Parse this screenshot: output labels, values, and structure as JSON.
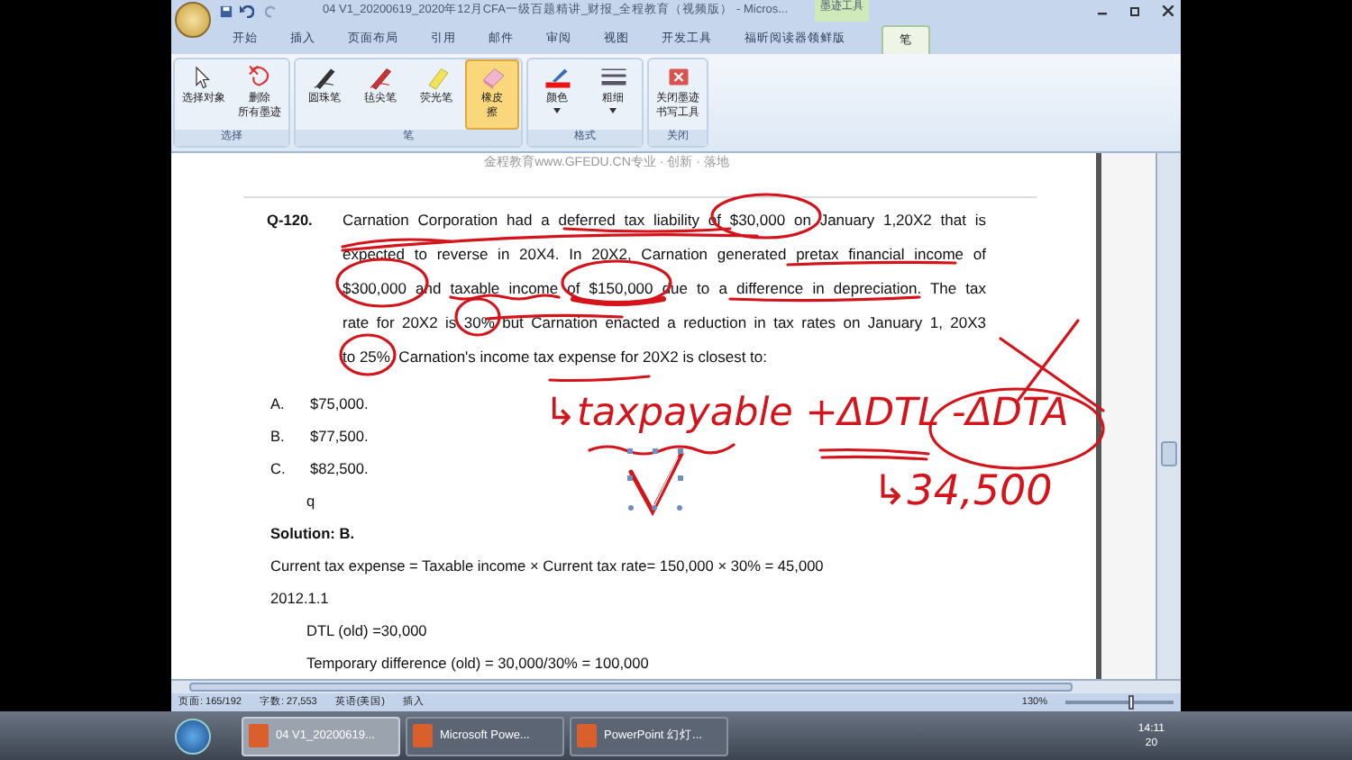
{
  "window": {
    "title": "04 V1_20200619_2020年12月CFA一级百题精讲_财报_全程教育（视频版） - Micros...",
    "contextual_tab": "墨迹工具"
  },
  "tabs": [
    {
      "label": "开始",
      "selected": false
    },
    {
      "label": "插入",
      "selected": false
    },
    {
      "label": "页面布局",
      "selected": false
    },
    {
      "label": "引用",
      "selected": false
    },
    {
      "label": "邮件",
      "selected": false
    },
    {
      "label": "审阅",
      "selected": false
    },
    {
      "label": "视图",
      "selected": false
    },
    {
      "label": "开发工具",
      "selected": false
    },
    {
      "label": "福昕阅读器领鲜版",
      "selected": false
    },
    {
      "label": "笔",
      "selected": true
    }
  ],
  "ribbon": [
    {
      "label": "选择",
      "buttons": [
        {
          "kind": "pointer",
          "lines": [
            "选择对象"
          ],
          "dropdown": false,
          "selected": false
        },
        {
          "kind": "erase-all",
          "lines": [
            "删除",
            "所有墨迹"
          ],
          "dropdown": false,
          "selected": false
        }
      ]
    },
    {
      "label": "笔",
      "buttons": [
        {
          "kind": "ballpoint",
          "lines": [
            "圆珠笔"
          ],
          "dropdown": false,
          "selected": false
        },
        {
          "kind": "felt",
          "lines": [
            "毡尖笔"
          ],
          "dropdown": false,
          "selected": false
        },
        {
          "kind": "highlighter",
          "lines": [
            "荧光笔"
          ],
          "dropdown": false,
          "selected": false
        },
        {
          "kind": "eraser",
          "lines": [
            "橡皮",
            "擦"
          ],
          "dropdown": false,
          "selected": true
        }
      ]
    },
    {
      "label": "格式",
      "buttons": [
        {
          "kind": "color",
          "lines": [
            "颜色"
          ],
          "dropdown": true,
          "selected": false
        },
        {
          "kind": "weight",
          "lines": [
            "粗细"
          ],
          "dropdown": true,
          "selected": false
        }
      ]
    },
    {
      "label": "关闭",
      "buttons": [
        {
          "kind": "close",
          "lines": [
            "关闭墨迹",
            "书写工具"
          ],
          "dropdown": false,
          "selected": false
        }
      ]
    }
  ],
  "document": {
    "header": "金程教育www.GFEDU.CN专业 · 创新 · 落地",
    "question": {
      "number": "Q-120.",
      "lines": [
        "Carnation Corporation had a deferred tax liability of $30,000 on January 1,20X2 that is",
        "expected to reverse in 20X4. In 20X2, Carnation generated pretax financial income of",
        "$300,000 and taxable income of $150,000 due to a difference in depreciation. The tax",
        "rate for 20X2 is 30% but Carnation enacted a reduction in tax rates on January 1, 20X3",
        "to 25%. Carnation's income tax expense for 20X2 is closest to:"
      ]
    },
    "options": [
      {
        "letter": "A.",
        "text": "$75,000."
      },
      {
        "letter": "B.",
        "text": "$77,500."
      },
      {
        "letter": "C.",
        "text": "$82,500."
      }
    ],
    "stray_line": "q",
    "solution": {
      "title": "Solution: B.",
      "lines": [
        {
          "text": "Current tax expense = Taxable income × Current tax rate= 150,000 × 30% = 45,000",
          "indented": false
        },
        {
          "text": "2012.1.1",
          "indented": false
        },
        {
          "text": "DTL (old) =30,000",
          "indented": true
        },
        {
          "text": "Temporary difference (old) = 30,000/30% = 100,000",
          "indented": true
        }
      ]
    },
    "ink_notes": [
      {
        "text": "↳taxpayable +ΔDTL -ΔDTA"
      },
      {
        "text": "↳34,500"
      }
    ]
  },
  "status_bar": {
    "items": [
      "页面: 165/192",
      "字数: 27,553",
      "英语(美国)",
      "插入"
    ],
    "zoom": {
      "reading": "130%",
      "level": 0.62
    }
  },
  "taskbar": {
    "tasks": [
      {
        "label": "04 V1_20200619...",
        "selected": true
      },
      {
        "label": "Microsoft Powe...",
        "selected": false
      },
      {
        "label": "PowerPoint 幻灯...",
        "selected": false
      }
    ],
    "clock": {
      "time": "14:11",
      "line_2": "20"
    }
  }
}
